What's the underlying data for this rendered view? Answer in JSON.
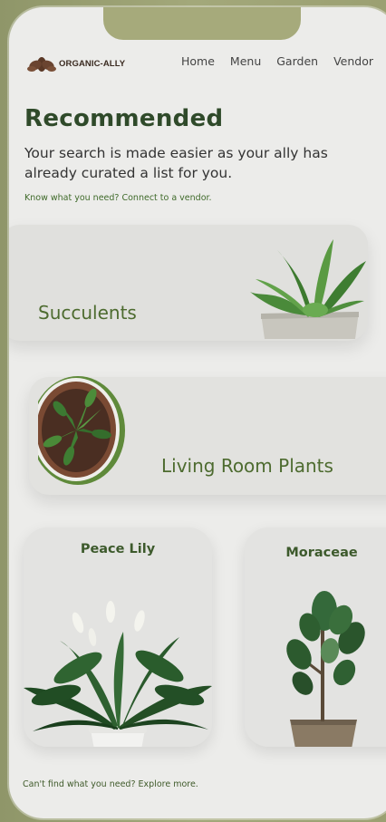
{
  "brand": {
    "name": "ORGANIC-ALLY",
    "logo_icon": "lotus-leaves-icon"
  },
  "nav": {
    "items": [
      "Home",
      "Menu",
      "Garden",
      "Vendor"
    ]
  },
  "header": {
    "title": "Recommended",
    "subtitle": "Your search is made easier as your ally has already curated a list for you.",
    "vendor_link": "Know what you need? Connect to a vendor."
  },
  "categories": [
    {
      "label": "Succulents",
      "icon": "succulent-plant-icon"
    },
    {
      "label": "Living Room Plants",
      "icon": "potted-plant-icon"
    }
  ],
  "plants": [
    {
      "name": "Peace Lily",
      "icon": "peace-lily-plant-icon"
    },
    {
      "name": "Moraceae",
      "icon": "fiddle-leaf-fig-icon"
    }
  ],
  "footer": {
    "explore_link": "Can't find what you need? Explore more."
  },
  "colors": {
    "accent_green": "#4d6b2f",
    "title_green": "#2f4a2a",
    "background": "#ececea",
    "frame": "#9aa071"
  }
}
